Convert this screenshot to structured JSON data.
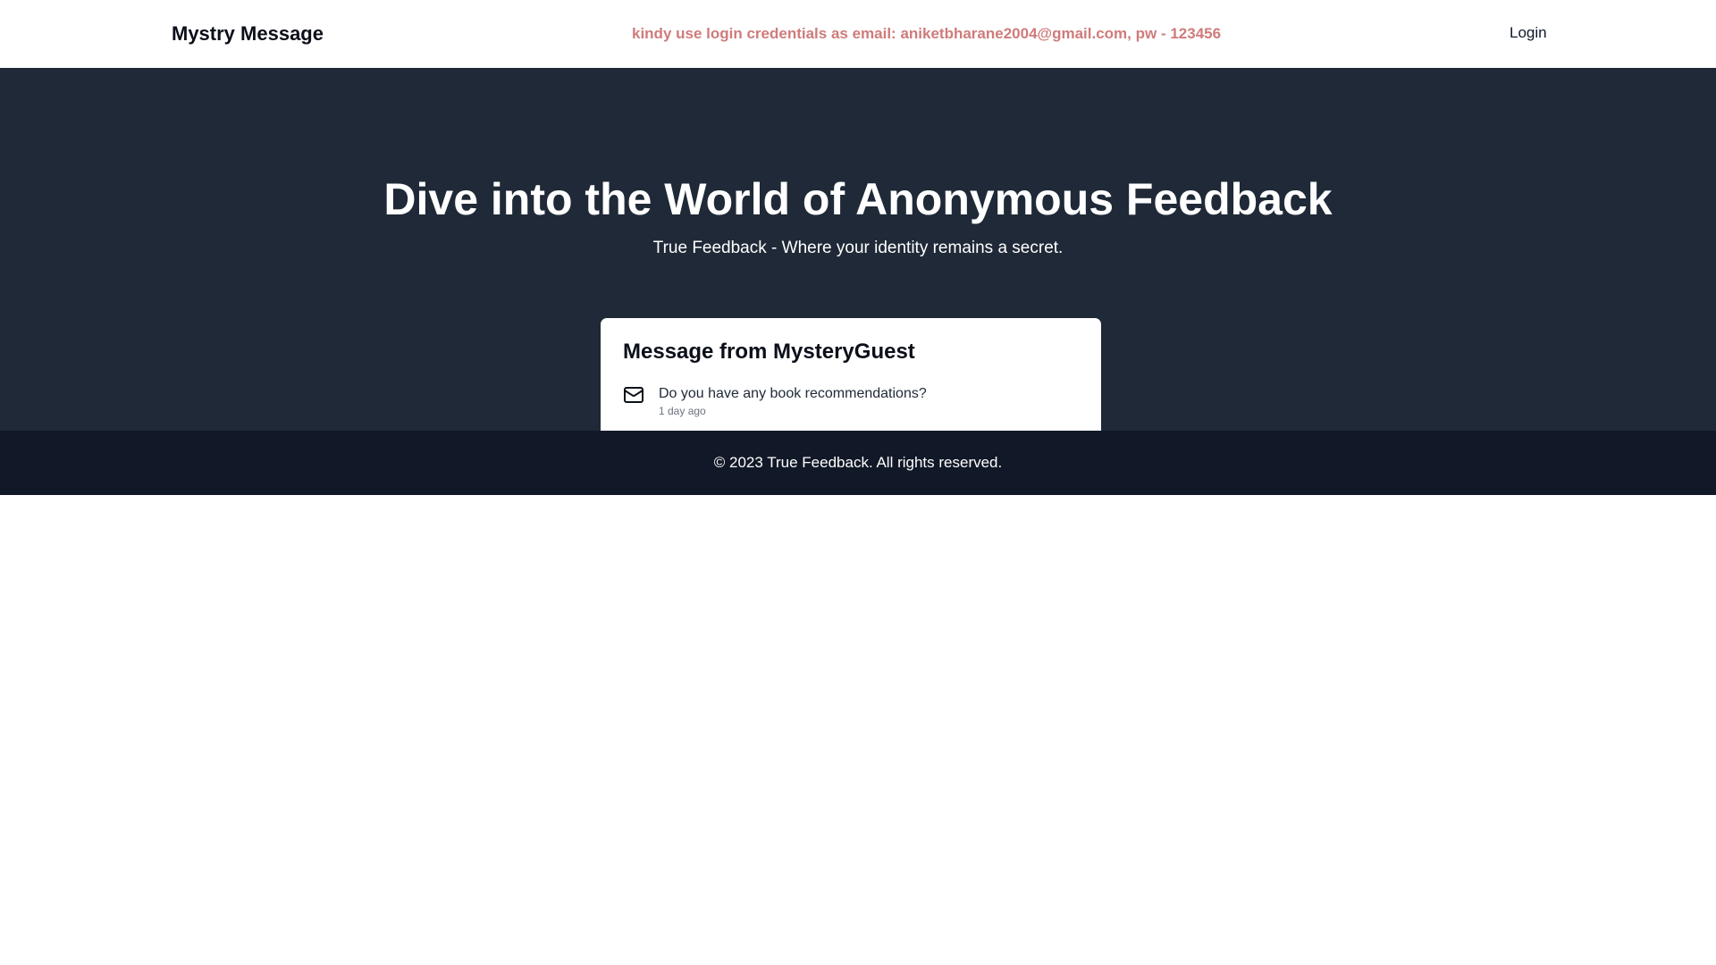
{
  "navbar": {
    "brand": "Mystry Message",
    "notice": "kindy use login credentials as email: aniketbharane2004@gmail.com, pw - 123456",
    "login_label": "Login"
  },
  "hero": {
    "title": "Dive into the World of Anonymous Feedback",
    "subtitle": "True Feedback - Where your identity remains a secret."
  },
  "message_card": {
    "title": "Message from MysteryGuest",
    "icon": "mail-icon",
    "text": "Do you have any book recommendations?",
    "time": "1 day ago"
  },
  "footer": {
    "text": "© 2023 True Feedback. All rights reserved."
  },
  "colors": {
    "hero_bg": "#1f2937",
    "footer_bg": "#111827",
    "notice": "#cf7b7b"
  }
}
